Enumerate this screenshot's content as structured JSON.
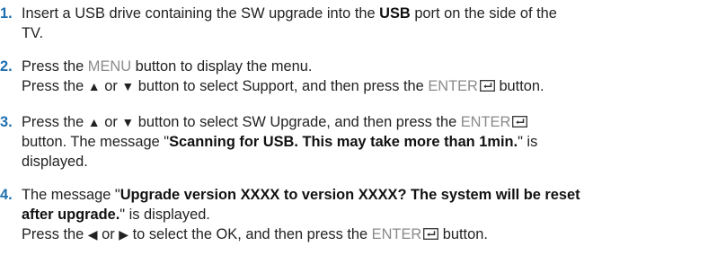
{
  "steps": [
    {
      "number": "1.",
      "text_a": "Insert a USB drive containing the SW upgrade into the ",
      "usb": "USB",
      "text_b": " port on the side of the",
      "text_c": "TV."
    },
    {
      "number": "2.",
      "l1_a": "Press the ",
      "menu": "MENU",
      "l1_b": " button to display the menu.",
      "l2_a": "Press the ",
      "up": "▲",
      "or": " or ",
      "down": "▼",
      "l2_b": " button to select Support, and then press the ",
      "enter": "ENTER",
      "l2_c": " button."
    },
    {
      "number": "3.",
      "l1_a": "Press the ",
      "up": "▲",
      "or": " or ",
      "down": "▼",
      "l1_b": " button to select SW Upgrade, and then press the ",
      "enter": "ENTER",
      "l2_a": "button. The message \"",
      "scan": "Scanning for USB. This may take more than 1min.",
      "l2_b": "\" is",
      "l3": "displayed."
    },
    {
      "number": "4.",
      "l1_a": "The message \"",
      "upgrade1": "Upgrade version XXXX to version XXXX? The system will be reset",
      "upgrade2": "after upgrade.",
      "l2_b": "\" is displayed.",
      "l3_a": "Press the ",
      "left": "◀",
      "or": " or ",
      "right": "▶",
      "l3_b": " to select the OK, and then press the ",
      "enter": "ENTER",
      "l3_c": " button."
    }
  ],
  "icons": {
    "enter": "enter-key-icon"
  },
  "colors": {
    "number": "#1f6fae",
    "emphasis_gray": "#8a8a8a"
  }
}
